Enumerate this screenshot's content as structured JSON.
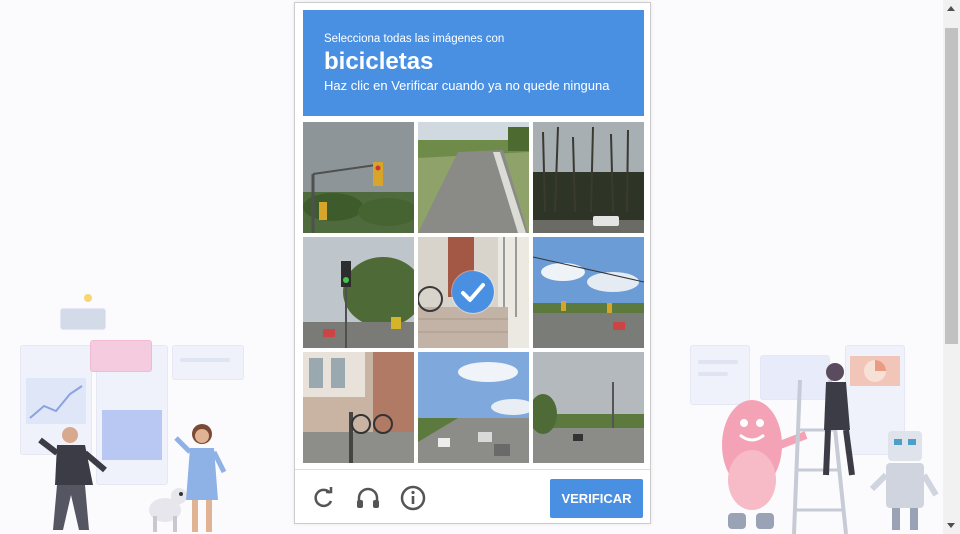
{
  "captcha": {
    "instruction_line1": "Selecciona todas las imágenes con",
    "target_object": "bicicletas",
    "instruction_line3": "Haz clic en Verificar cuando ya no quede ninguna",
    "verify_label": "VERIFICAR",
    "header_color": "#4a90e2",
    "tiles": [
      {
        "scene": "traffic-light-street",
        "selected": false
      },
      {
        "scene": "curved-road",
        "selected": false
      },
      {
        "scene": "forest-parking",
        "selected": false
      },
      {
        "scene": "traffic-light-trees",
        "selected": false
      },
      {
        "scene": "bicycle-wall",
        "selected": true
      },
      {
        "scene": "intersection-traffic-lights",
        "selected": false
      },
      {
        "scene": "building-bicycle",
        "selected": false
      },
      {
        "scene": "highway-cars",
        "selected": false
      },
      {
        "scene": "road-overcast",
        "selected": false
      }
    ],
    "footer_icons": [
      "reload-icon",
      "headphones-icon",
      "info-icon"
    ]
  }
}
